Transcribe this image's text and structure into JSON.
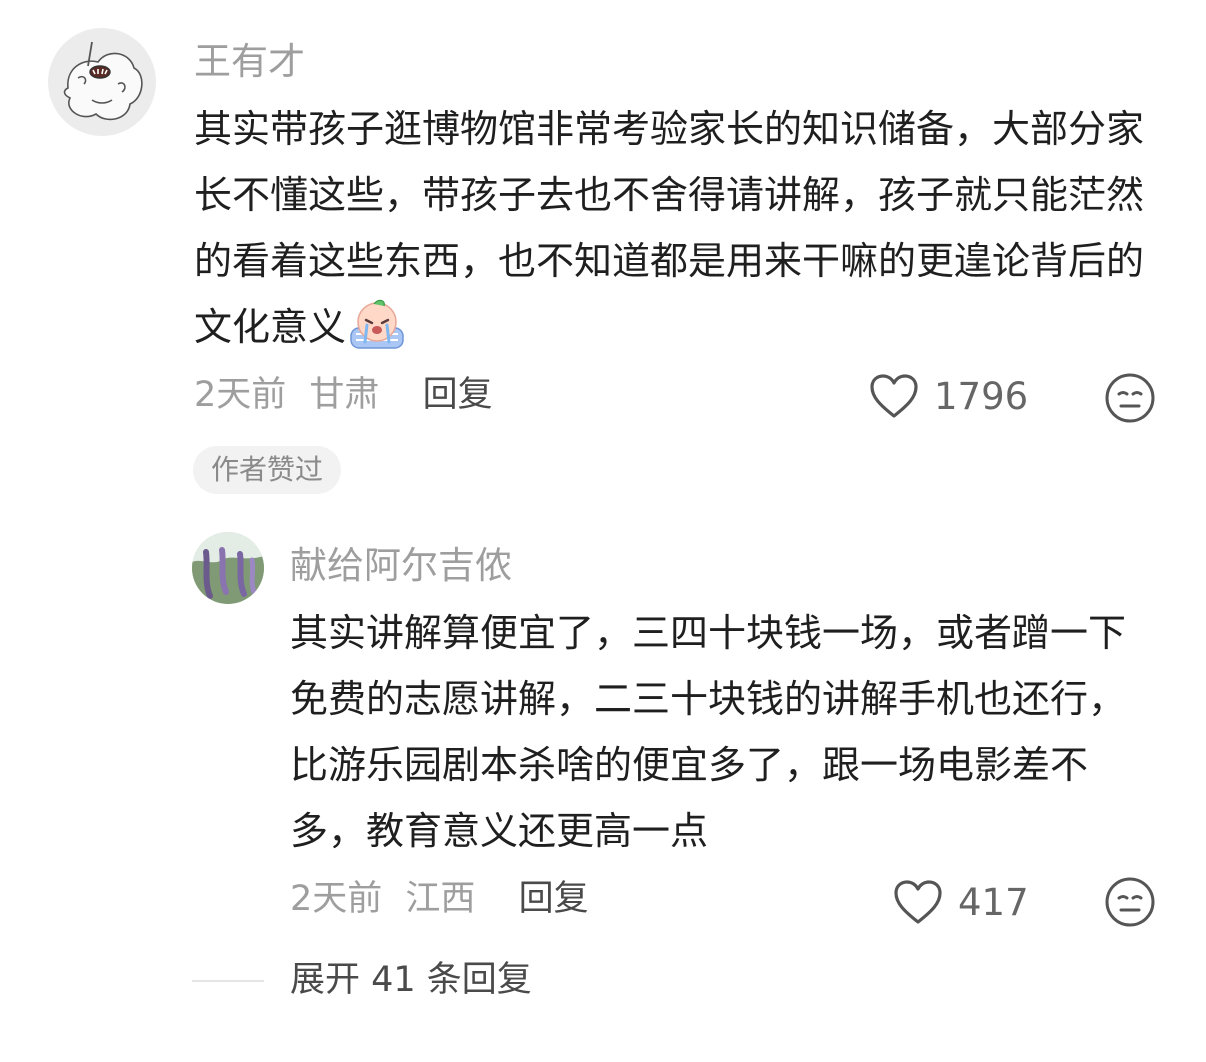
{
  "comments": [
    {
      "username": "王有才",
      "text": "其实带孩子逛博物馆非常考验家长的知识储备，大部分家长不懂这些，带孩子去也不舍得请讲解，孩子就只能茫然的看着这些东西，也不知道都是用来干嘛的更遑论背后的文化意义",
      "emoji": "crying-face-emoji",
      "time": "2天前",
      "location": "甘肃",
      "reply_label": "回复",
      "likes": "1796",
      "badge": "作者赞过",
      "replies": [
        {
          "username": "献给阿尔吉侬",
          "text": "其实讲解算便宜了，三四十块钱一场，或者蹭一下免费的志愿讲解，二三十块钱的讲解手机也还行，比游乐园剧本杀啥的便宜多了，跟一场电影差不多，教育意义还更高一点",
          "time": "2天前",
          "location": "江西",
          "reply_label": "回复",
          "likes": "417"
        }
      ],
      "expand_label": "展开 41 条回复"
    }
  ],
  "colors": {
    "secondary_text": "#9e9e9e",
    "primary_text": "#1f1f1f",
    "badge_bg": "#f2f2f2"
  }
}
